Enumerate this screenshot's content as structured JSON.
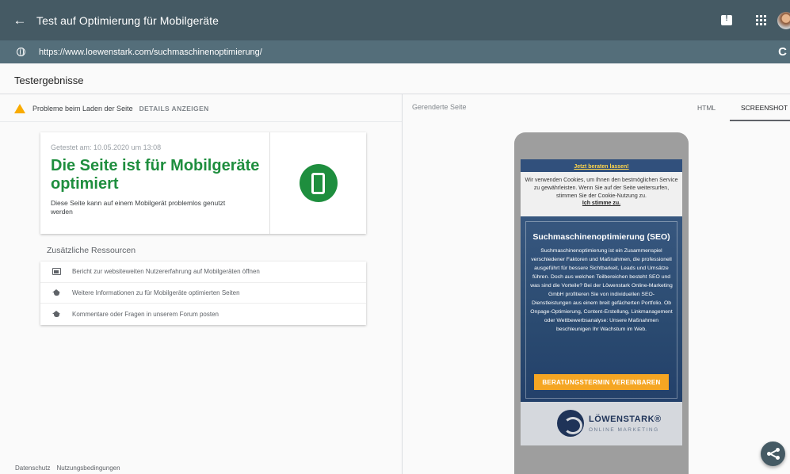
{
  "topbar": {
    "title": "Test auf Optimierung für Mobilgeräte",
    "back_icon": "arrow-back-icon",
    "feedback_icon": "feedback-icon",
    "apps_icon": "apps-grid-icon"
  },
  "urlbar": {
    "url": "https://www.loewenstark.com/suchmaschinenoptimierung/",
    "reload_icon": "C"
  },
  "results": {
    "title": "Testergebnisse"
  },
  "warning": {
    "text": "Probleme beim Laden der Seite",
    "details_label": "DETAILS ANZEIGEN",
    "color": "#f9ab00"
  },
  "result_card": {
    "tested": "Getestet am: 10.05.2020 um 13:08",
    "headline": "Die Seite ist für Mobilgeräte optimiert",
    "description": "Diese Seite kann auf einem Mobilgerät problemlos genutzt werden",
    "accent_color": "#1e8e3e"
  },
  "resources": {
    "title": "Zusätzliche Ressourcen",
    "items": [
      {
        "icon": "report-icon",
        "label": "Bericht zur websiteweiten Nutzererfahrung auf Mobilgeräten öffnen"
      },
      {
        "icon": "school-icon",
        "label": "Weitere Informationen zu für Mobilgeräte optimierten Seiten"
      },
      {
        "icon": "school-icon",
        "label": "Kommentare oder Fragen in unserem Forum posten"
      }
    ]
  },
  "footer": {
    "privacy": "Datenschutz",
    "terms": "Nutzungsbedingungen"
  },
  "preview": {
    "label": "Gerenderte Seite",
    "tab_html": "HTML",
    "tab_screenshot": "SCREENSHOT"
  },
  "phone_page": {
    "beraten": "Jetzt beraten lassen!",
    "cookie_text": "Wir verwenden Cookies, um Ihnen den bestmöglichen Service zu gewährleisten. Wenn Sie auf der Seite weitersurfen, stimmen Sie der Cookie-Nutzung zu.",
    "cookie_accept": "Ich stimme zu.",
    "hero_title": "Suchmaschinenoptimierung (SEO)",
    "hero_body": "Suchmaschinenoptimierung ist ein Zusammenspiel verschiedener Faktoren und Maßnahmen, die professionell ausgeführt für bessere Sichtbarkeit, Leads und Umsätze führen. Doch aus welchen Teilbereichen besteht SEO und was sind die Vorteile? Bei der Löwenstark Online-Marketing GmbH profitieren Sie von individuellen SEO-Dienstleistungen aus einem breit gefächerten Portfolio. Ob Onpage-Optimierung, Content-Erstellung, Linkmanagement oder Wettbewerbsanalyse: Unsere Maßnahmen beschleunigen Ihr Wachstum im Web.",
    "cta": "BERATUNGSTERMIN VEREINBAREN",
    "logo_name": "LÖWENSTARK®",
    "logo_sub": "ONLINE MARKETING"
  }
}
